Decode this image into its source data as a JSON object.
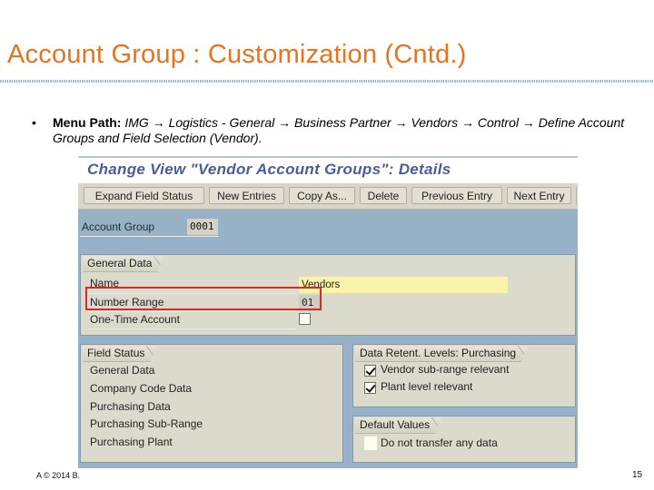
{
  "slide": {
    "title": "Account Group : Customization (Cntd.)",
    "bullet": {
      "label": "Menu Path:",
      "path": " IMG → Logistics - General → Business Partner → Vendors → Control → Define Account Groups and Field Selection (Vendor)."
    },
    "footer_copyright": "A © 2014 B.",
    "page_number": "15",
    "colors": {
      "title": "#e8731e",
      "highlight": "#d42a2a"
    }
  },
  "sap": {
    "title": "Change View \"Vendor Account Groups\": Details",
    "toolbar": [
      {
        "label": "Expand Field Status"
      },
      {
        "label": "New Entries"
      },
      {
        "label": "Copy As..."
      },
      {
        "label": "Delete"
      },
      {
        "label": "Previous Entry"
      },
      {
        "label": "Next Entry"
      }
    ],
    "account_group": {
      "label": "Account Group",
      "value": "0001"
    },
    "general_data": {
      "tab": "General Data",
      "name": {
        "label": "Name",
        "value": "Vendors"
      },
      "number_range": {
        "label": "Number Range",
        "value": "01"
      },
      "one_time_account": {
        "label": "One-Time Account",
        "checked": false
      }
    },
    "field_status": {
      "tab": "Field Status",
      "items": [
        "General Data",
        "Company Code Data",
        "Purchasing Data",
        "Purchasing Sub-Range",
        "Purchasing Plant"
      ]
    },
    "data_retention": {
      "tab": "Data Retent. Levels: Purchasing",
      "items": [
        {
          "label": "Vendor sub-range relevant",
          "checked": true
        },
        {
          "label": "Plant level relevant",
          "checked": true
        }
      ]
    },
    "default_values": {
      "tab": "Default Values",
      "items": [
        {
          "label": "Do not transfer any data",
          "checked": false
        }
      ]
    }
  }
}
